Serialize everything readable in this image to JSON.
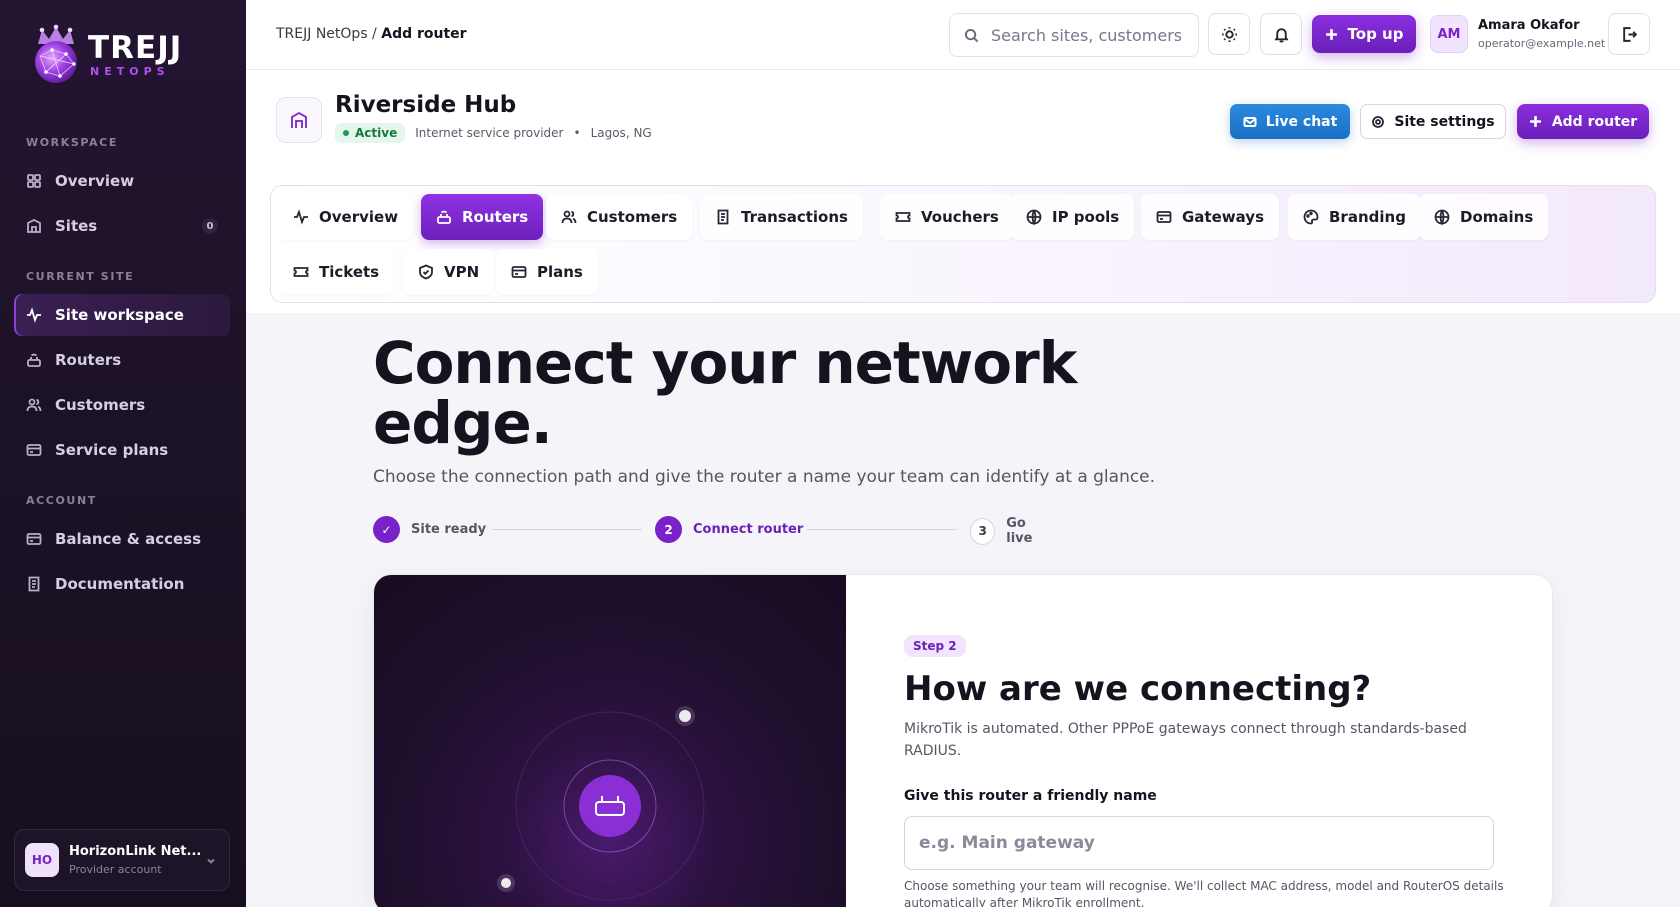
{
  "brand": {
    "word": "TREJJ",
    "sub": "NETOPS"
  },
  "sidebar": {
    "sections": [
      {
        "label": "WORKSPACE"
      },
      {
        "label": "CURRENT SITE"
      },
      {
        "label": "ACCOUNT"
      }
    ],
    "items": [
      {
        "label": "Overview",
        "icon": "grid-icon"
      },
      {
        "label": "Sites",
        "icon": "building-icon",
        "badge": "0"
      },
      {
        "label": "Site workspace",
        "icon": "activity-icon",
        "active": true
      },
      {
        "label": "Routers",
        "icon": "router-icon"
      },
      {
        "label": "Customers",
        "icon": "users-icon"
      },
      {
        "label": "Service plans",
        "icon": "card-icon"
      },
      {
        "label": "Balance & access",
        "icon": "wallet-icon"
      },
      {
        "label": "Documentation",
        "icon": "document-icon"
      }
    ],
    "account": {
      "initials": "HO",
      "name": "HorizonLink Net...",
      "sub": "Provider account"
    }
  },
  "topbar": {
    "breadcrumb_root": "TREJJ NetOps /",
    "breadcrumb_current": "Add router",
    "search_placeholder": "Search sites, customers...",
    "topup_label": "Top up",
    "user": {
      "initials": "AM",
      "name": "Amara Okafor",
      "email": "operator@example.net"
    }
  },
  "site": {
    "name": "Riverside Hub",
    "status": "Active",
    "type": "Internet service provider",
    "separator": "•",
    "location": "Lagos, NG",
    "live_chat": "Live chat",
    "settings": "Site settings",
    "add_router": "Add router",
    "tabs": [
      {
        "label": "Overview",
        "icon": "activity-icon"
      },
      {
        "label": "Routers",
        "icon": "router-icon",
        "active": true
      },
      {
        "label": "Customers",
        "icon": "users-icon"
      },
      {
        "label": "Transactions",
        "icon": "receipt-icon"
      },
      {
        "label": "Vouchers",
        "icon": "ticket-icon"
      },
      {
        "label": "IP pools",
        "icon": "globe-icon"
      },
      {
        "label": "Gateways",
        "icon": "card-icon"
      },
      {
        "label": "Branding",
        "icon": "palette-icon"
      },
      {
        "label": "Domains",
        "icon": "globe-icon"
      },
      {
        "label": "Tickets",
        "icon": "ticket-icon"
      },
      {
        "label": "VPN",
        "icon": "shield-icon"
      },
      {
        "label": "Plans",
        "icon": "card-icon"
      }
    ]
  },
  "main": {
    "hero_line1": "Connect your network",
    "hero_line2": "edge.",
    "subtitle": "Choose the connection path and give the router a name your team can identify at a glance.",
    "steps": [
      {
        "number": "✓",
        "label": "Site ready",
        "state": "done"
      },
      {
        "number": "2",
        "label": "Connect router",
        "state": "current"
      },
      {
        "number": "3",
        "label": "Go live",
        "state": "upcoming"
      }
    ],
    "card": {
      "step_pill": "Step 2",
      "title": "How are we connecting?",
      "description": "MikroTik is automated. Other PPPoE gateways connect through standards-based RADIUS.",
      "field_label": "Give this router a friendly name",
      "field_placeholder": "e.g. Main gateway",
      "field_value": "",
      "field_help": "Choose something your team will recognise. We'll collect MAC address, model and RouterOS details automatically after MikroTik enrollment."
    }
  },
  "colors": {
    "accent": "#7a22c9",
    "sidebar_bg": "#1c1226",
    "live_chat": "#1c6fc4",
    "status_active": "#137a3e"
  }
}
